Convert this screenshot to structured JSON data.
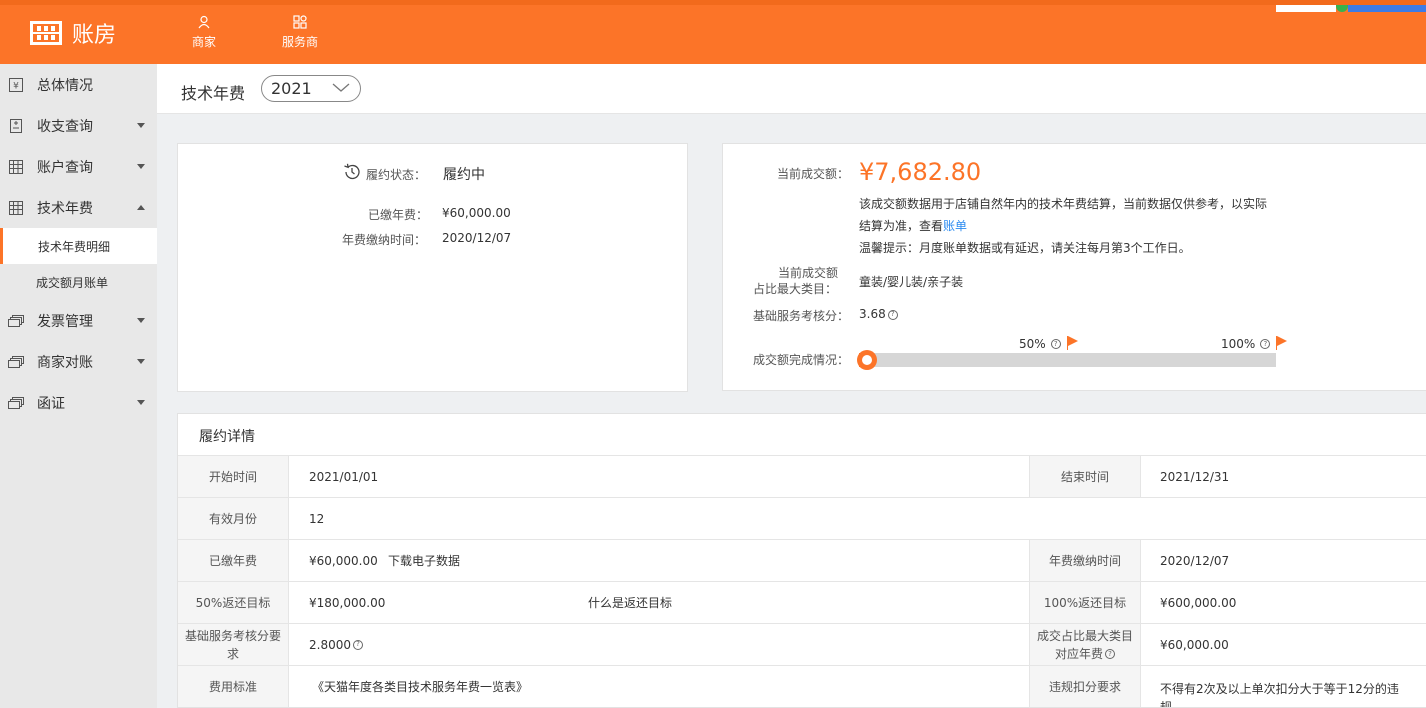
{
  "app": {
    "brand": "账房",
    "top_nav": [
      {
        "label": "商家",
        "icon": "user-icon"
      },
      {
        "label": "服务商",
        "icon": "grid-icon"
      }
    ]
  },
  "sidebar": {
    "items": [
      {
        "label": "总体情况",
        "icon": "yen-icon"
      },
      {
        "label": "收支查询",
        "icon": "doc-icon"
      },
      {
        "label": "账户查询",
        "icon": "table-icon"
      },
      {
        "label": "技术年费",
        "icon": "table-icon"
      },
      {
        "label": "发票管理",
        "icon": "stack-icon"
      },
      {
        "label": "商家对账",
        "icon": "stack-icon"
      },
      {
        "label": "函证",
        "icon": "stack-icon"
      }
    ],
    "sub_items": [
      {
        "label": "技术年费明细",
        "active": true
      },
      {
        "label": "成交额月账单",
        "active": false
      }
    ]
  },
  "header": {
    "title": "技术年费",
    "year": "2021"
  },
  "status_card": {
    "status_label": "履约状态：",
    "status_value": "履约中",
    "paid_label": "已缴年费：",
    "paid_value": "¥60,000.00",
    "pay_time_label": "年费缴纳时间：",
    "pay_time_value": "2020/12/07"
  },
  "turnover_card": {
    "current_label": "当前成交额：",
    "current_amount": "¥7,682.80",
    "desc_line1": "该成交额数据用于店铺自然年内的技术年费结算，当前数据仅供参考，以实际",
    "desc_line2_prefix": "结算为准，查看",
    "desc_link": "账单",
    "tip": "温馨提示：月度账单数据或有延迟，请关注每月第3个工作日。",
    "category_label_1": "当前成交额",
    "category_label_2": "占比最大类目：",
    "category_value": "童装/婴儿装/亲子装",
    "score_label": "基础服务考核分：",
    "score_value": "3.68",
    "progress_label": "成交额完成情况：",
    "progress_fraction": 0.01,
    "mark_50": "50%",
    "mark_100": "100%"
  },
  "details": {
    "title": "履约详情",
    "start_label": "开始时间",
    "start_value": "2021/01/01",
    "end_label": "结束时间",
    "end_value": "2021/12/31",
    "months_label": "有效月份",
    "months_value": "12",
    "paid_label": "已缴年费",
    "paid_value": "¥60,000.00",
    "download_link": "下载电子数据",
    "pay_time_label": "年费缴纳时间",
    "pay_time_value": "2020/12/07",
    "target50_label": "50%返还目标",
    "target50_value": "¥180,000.00",
    "target_help_link": "什么是返还目标",
    "target100_label": "100%返还目标",
    "target100_value": "¥600,000.00",
    "score_req_label_1": "基础服务考核分要",
    "score_req_label_2": "求",
    "score_req_value": "2.8000",
    "max_cat_fee_label_1": "成交占比最大类目",
    "max_cat_fee_label_2": "对应年费",
    "max_cat_fee_value": "¥60,000.00",
    "fee_std_label": "费用标准",
    "fee_std_link": "《天猫年度各类目技术服务年费一览表》",
    "violation_label": "违规扣分要求",
    "violation_value_1": "不得有2次及以上单次扣分大于等于12分的违",
    "violation_value_2": "规"
  },
  "colors": {
    "brand": "#fc7428",
    "link": "#2d8cf0",
    "sidebar_bg": "#e8e8e8"
  }
}
